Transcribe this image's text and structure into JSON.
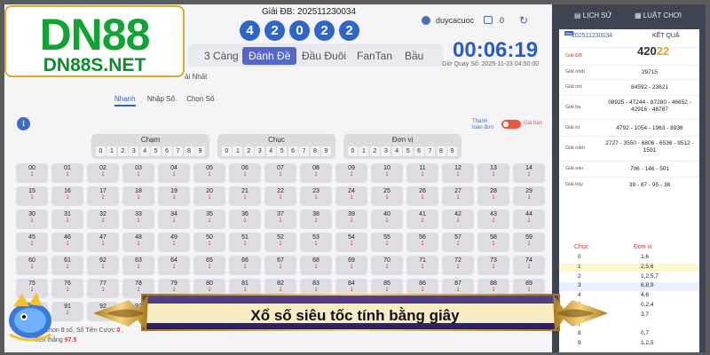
{
  "logo": {
    "main": "DN88",
    "sub": "DN88S.NET"
  },
  "header": {
    "special_prize_label": "Giải ĐB: 202511230034",
    "balls": [
      "4",
      "2",
      "0",
      "2",
      "2"
    ],
    "username": "duycacuoc",
    "balance": "0",
    "reload_icon": "refresh-icon"
  },
  "tabs": [
    {
      "label": "3 Càng",
      "active": false
    },
    {
      "label": "Đánh Đề",
      "active": true
    },
    {
      "label": "Đầu Đuôi",
      "active": false
    },
    {
      "label": "FanTan",
      "active": false
    },
    {
      "label": "Bầu",
      "active": false
    }
  ],
  "timer": {
    "countdown": "00:06:19",
    "draw_time": "Giờ Quay Số: 2025-11-23 04:50:00"
  },
  "partial_label": "ải Nhất",
  "sub_tabs": [
    "Nhanh",
    "Nhập Số",
    "Chọn Số"
  ],
  "payment": {
    "label": "Thanh toán đơn",
    "toggle_label": "Giá bán"
  },
  "pickers": [
    {
      "title": "Chạm",
      "digits": [
        "0",
        "1",
        "2",
        "3",
        "4",
        "5",
        "6",
        "7",
        "8",
        "9"
      ]
    },
    {
      "title": "Chục",
      "digits": [
        "0",
        "1",
        "2",
        "3",
        "4",
        "5",
        "6",
        "7",
        "8",
        "9"
      ]
    },
    {
      "title": "Đơn vị",
      "digits": [
        "0",
        "1",
        "2",
        "3",
        "4",
        "5",
        "6",
        "7",
        "8",
        "9"
      ]
    }
  ],
  "number_grid": {
    "numbers": [
      "00",
      "01",
      "02",
      "03",
      "04",
      "05",
      "06",
      "07",
      "08",
      "09",
      "10",
      "11",
      "12",
      "13",
      "14",
      "15",
      "16",
      "17",
      "18",
      "19",
      "20",
      "21",
      "22",
      "23",
      "24",
      "25",
      "26",
      "27",
      "28",
      "29",
      "30",
      "31",
      "32",
      "33",
      "34",
      "35",
      "36",
      "37",
      "38",
      "39",
      "40",
      "41",
      "42",
      "43",
      "44",
      "45",
      "46",
      "47",
      "48",
      "49",
      "50",
      "51",
      "52",
      "53",
      "54",
      "55",
      "56",
      "57",
      "58",
      "59",
      "60",
      "61",
      "62",
      "63",
      "64",
      "65",
      "66",
      "67",
      "68",
      "69",
      "70",
      "71",
      "72",
      "73",
      "74",
      "75",
      "76",
      "77",
      "78",
      "79",
      "80",
      "81",
      "82",
      "83",
      "84",
      "85",
      "86",
      "87",
      "88",
      "89",
      "90",
      "91",
      "92",
      "93"
    ],
    "odds": "1"
  },
  "bottom": {
    "line1_a": "Chọn",
    "selected": "0",
    "line1_b": "số,",
    "total_label": "Số Tiền Cược",
    "total_value": "0",
    "line1_c": ",",
    "win_label": "Tiền thắng",
    "win_value": "97.5"
  },
  "right_panel": {
    "history_label": "LỊCH SỬ",
    "rules_label": "LUẬT CHƠI",
    "new_tag": "New",
    "draw_code": "202511230034",
    "result_label": "KẾT QUẢ",
    "result_main": "420",
    "result_highlight": "22",
    "prizes": [
      {
        "name": "Giải ĐB",
        "value": ""
      },
      {
        "name": "Giải nhất",
        "value": "29715"
      },
      {
        "name": "Giải nhì",
        "value": "84592 - 23621"
      },
      {
        "name": "Giải ba",
        "value": "08925 - 47244 - 87280 - 46652 - 42916 - 48787"
      },
      {
        "name": "Giải tư",
        "value": "4792 - 1054 - 1963 - 8936"
      },
      {
        "name": "Giải năm",
        "value": "2727 - 3550 - 6806 - 6536 - 9512 - 1591"
      },
      {
        "name": "Giải sáu",
        "value": "706 - 146 - 501"
      },
      {
        "name": "Giải bảy",
        "value": "39 - 67 - 95 - 38"
      }
    ],
    "table_head": {
      "tens": "Chục",
      "units": "Đơn vị"
    },
    "table_rows": [
      {
        "tens": "0",
        "units": "1,6"
      },
      {
        "tens": "1",
        "units": "2,5,6"
      },
      {
        "tens": "2",
        "units": "1,2,5,7"
      },
      {
        "tens": "3",
        "units": "6,8,9"
      },
      {
        "tens": "4",
        "units": "4,6"
      },
      {
        "tens": "5",
        "units": "0,2,4"
      },
      {
        "tens": "6",
        "units": "3,7"
      },
      {
        "tens": "7",
        "units": ""
      },
      {
        "tens": "8",
        "units": "0,7"
      },
      {
        "tens": "9",
        "units": "1,2,5"
      }
    ]
  },
  "banner": {
    "text": "Xổ số siêu tốc tính bằng giây"
  },
  "colors": {
    "brand_green": "#13a335",
    "accent_blue": "#2f64c8",
    "gold": "#d9a930",
    "banner_purple": "#3d2a6e"
  }
}
